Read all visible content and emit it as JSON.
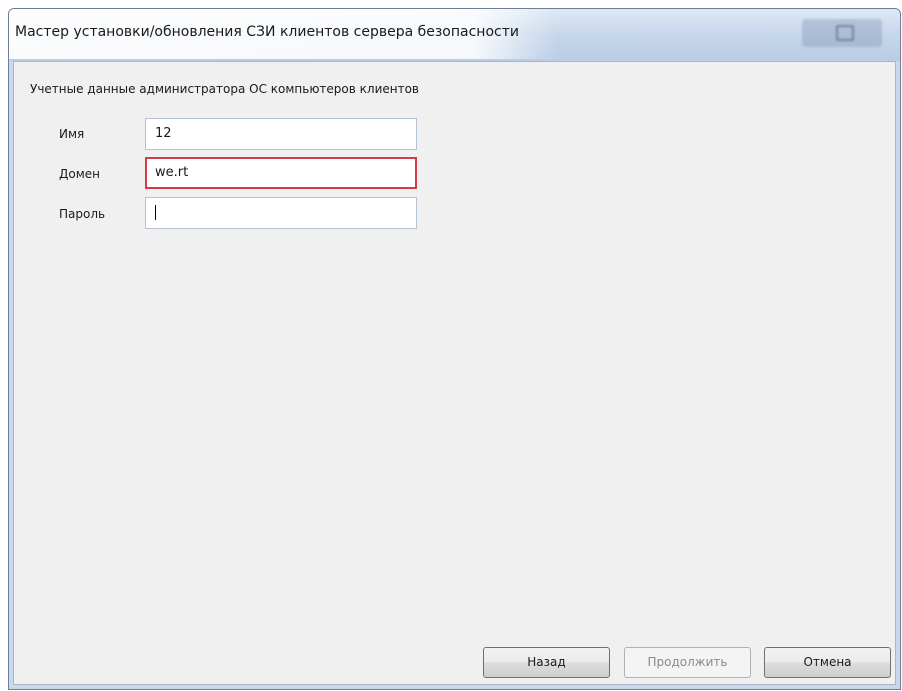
{
  "window": {
    "title": "Мастер установки/обновления СЗИ клиентов сервера безопасности"
  },
  "section": {
    "header": "Учетные данные администратора ОС компьютеров клиентов"
  },
  "form": {
    "fields": [
      {
        "label": "Имя",
        "value": "12",
        "state": "normal"
      },
      {
        "label": "Домен",
        "value": "we.rt",
        "state": "error"
      },
      {
        "label": "Пароль",
        "value": "",
        "state": "focused"
      }
    ],
    "error_border_color": "#d63a45"
  },
  "buttons": {
    "back_label": "Назад",
    "next_label": "Продолжить",
    "next_enabled": false,
    "cancel_label": "Отмена"
  }
}
